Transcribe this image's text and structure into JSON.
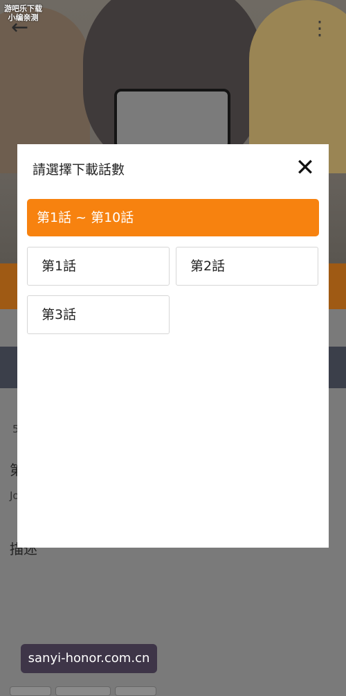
{
  "top_watermark": {
    "line1": "游吧乐下载",
    "line2": "小编亲测"
  },
  "background": {
    "left_partial_text_1": "5",
    "left_partial_text_2": "第",
    "left_partial_text_3": "Jo",
    "left_partial_text_4": "描述"
  },
  "modal": {
    "title": "請選擇下載話數",
    "range_label": "第1話 ~ 第10話",
    "episodes": [
      "第1話",
      "第2話",
      "第3話"
    ],
    "close_icon": "close-icon"
  },
  "footer": {
    "watermark": "sanyi-honor.com.cn"
  },
  "colors": {
    "accent": "#f7820f",
    "overlay": "#7a7a7a"
  }
}
